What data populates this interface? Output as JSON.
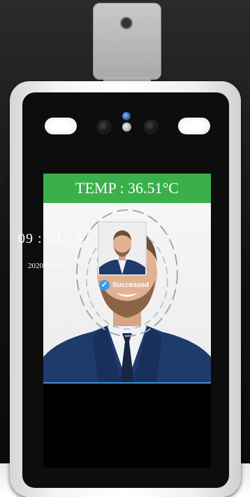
{
  "screen": {
    "temperature_label": "TEMP : 36.51°C",
    "time": "09 : 24 : 52",
    "date": "2020/05/12",
    "status_text": "Successed",
    "accent_green": "#3ab04a",
    "accent_blue": "#3a9bf2"
  },
  "icons": {
    "status": "check-circle-icon"
  }
}
